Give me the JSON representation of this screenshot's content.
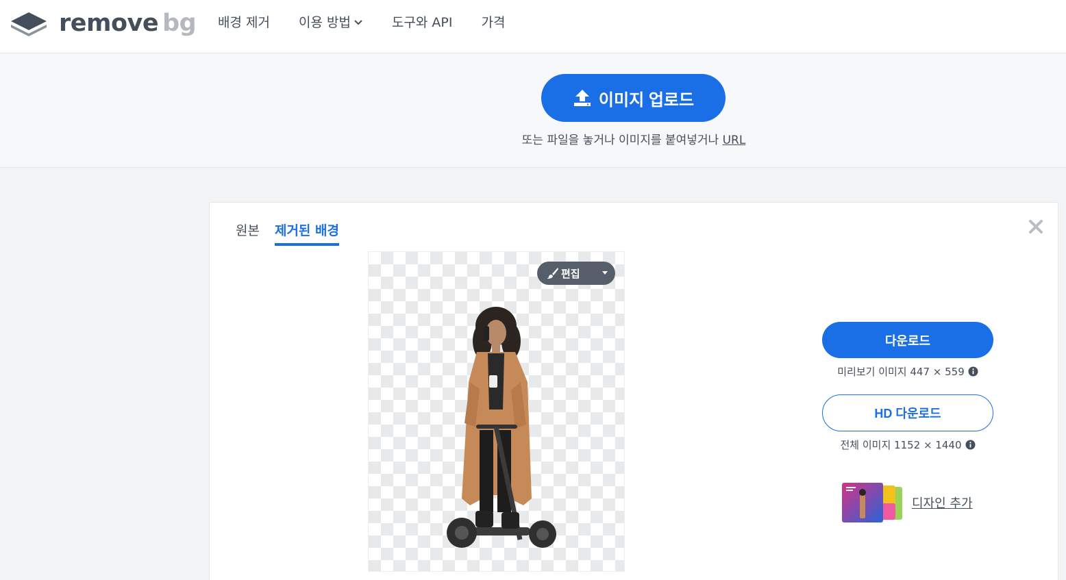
{
  "brand": {
    "remove": "remove",
    "bg": "bg"
  },
  "nav": {
    "items": [
      {
        "label": "배경 제거"
      },
      {
        "label": "이용 방법"
      },
      {
        "label": "도구와 API"
      },
      {
        "label": "가격"
      }
    ]
  },
  "upload": {
    "button_label": "이미지 업로드",
    "hint": "또는 파일을 놓거나 이미지를 붙여넣거나 ",
    "url_label": "URL"
  },
  "tabs": [
    {
      "label": "원본",
      "active": false
    },
    {
      "label": "제거된 배경",
      "active": true
    }
  ],
  "editor": {
    "edit_label": "편집"
  },
  "download": {
    "label": "다운로드",
    "preview_info": "미리보기 이미지 447 × 559",
    "hd_label": "HD 다운로드",
    "full_info": "전체 이미지 1152 × 1440"
  },
  "design": {
    "label": "디자인 추가"
  },
  "colors": {
    "accent": "#1a6ee6",
    "text": "#454f5b",
    "edit_bg": "#565f69"
  }
}
